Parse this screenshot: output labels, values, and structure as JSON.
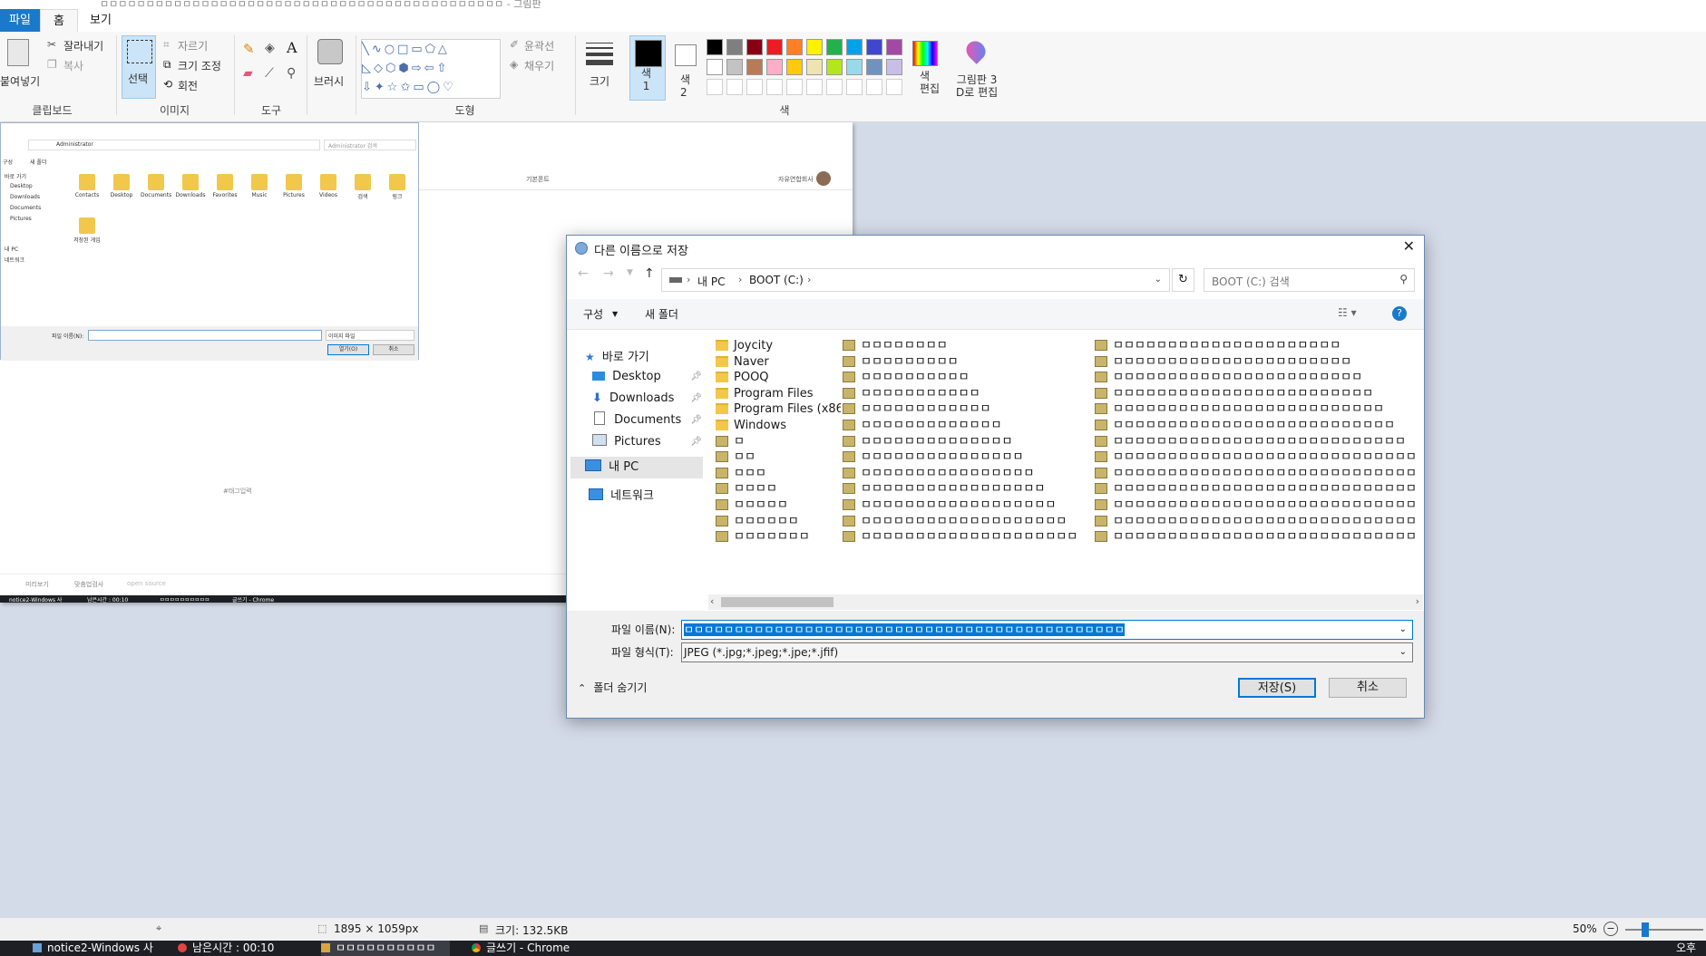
{
  "paint": {
    "title": "ㅁㅁㅁㅁㅁㅁㅁㅁㅁㅁㅁㅁㅁㅁㅁㅁㅁㅁㅁㅁㅁㅁㅁㅁㅁㅁㅁㅁㅁㅁㅁㅁㅁㅁㅁㅁㅁㅁㅁㅁㅁㅁㅁㅁ - 그림판",
    "tabs": [
      "파일",
      "홈",
      "보기"
    ],
    "clipboard": {
      "paste": "붙여넣기",
      "cut": "잘라내기",
      "copy": "복사",
      "group": "클립보드"
    },
    "image": {
      "select": "선택",
      "crop": "자르기",
      "resize": "크기 조정",
      "rotate": "회전",
      "group": "이미지"
    },
    "tools": {
      "group": "도구"
    },
    "brushes": {
      "label": "브러시"
    },
    "shapes": {
      "outline": "윤곽선",
      "fill": "채우기",
      "group": "도형"
    },
    "size": {
      "label": "크기"
    },
    "colors": {
      "color1": "색\n1",
      "color2": "색\n2",
      "edit": "색\n편집",
      "paint3d": "그림판 3\nD로 편집",
      "group": "색",
      "palette_row1": [
        "#000000",
        "#7f7f7f",
        "#880015",
        "#ed1c24",
        "#ff7f27",
        "#fff200",
        "#22b14c",
        "#00a2e8",
        "#3f48cc",
        "#a349a4"
      ],
      "palette_row2": [
        "#ffffff",
        "#c3c3c3",
        "#b97a57",
        "#ffaec9",
        "#ffc90e",
        "#efe4b0",
        "#b5e61d",
        "#99d9ea",
        "#7092be",
        "#c8bfe7"
      ]
    },
    "status": {
      "dimensions": "1895 × 1059px",
      "size": "크기: 132.5KB",
      "zoom": "50%"
    }
  },
  "canvas_content": {
    "mini_dialog": {
      "breadcrumb": "Administrator",
      "search": "Administrator 검색",
      "organize": "구성",
      "new_folder": "새 폴더",
      "nav": [
        "바로 가기",
        "Desktop",
        "Downloads",
        "Documents",
        "Pictures",
        "내 PC",
        "네트워크"
      ],
      "items": [
        "Contacts",
        "Desktop",
        "Documents",
        "Downloads",
        "Favorites",
        "Music",
        "Pictures",
        "Videos",
        "검색",
        "링크",
        "저장된 게임"
      ],
      "filename_label": "파일 이름(N):",
      "filetype": "이미지 파일",
      "open": "열기(O)",
      "cancel": "취소"
    },
    "editor_label": "기본폰트",
    "user": "자유연합회사",
    "tags": "#태그입력",
    "bottom": [
      "미리보기",
      "맞춤법검사",
      "open source"
    ],
    "taskbar": [
      "notice2-Windows 사",
      "남은시간 : 00:10",
      "ㅁㅁㅁㅁㅁㅁㅁㅁㅁㅁ",
      "글쓰기 - Chrome"
    ]
  },
  "dialog": {
    "title": "다른 이름으로 저장",
    "breadcrumb": [
      "내 PC",
      "BOOT (C:)"
    ],
    "search_placeholder": "BOOT (C:) 검색",
    "organize": "구성",
    "new_folder": "새 폴더",
    "nav": {
      "quick": "바로 가기",
      "desktop": "Desktop",
      "downloads": "Downloads",
      "documents": "Documents",
      "pictures": "Pictures",
      "mypc": "내 PC",
      "network": "네트워크"
    },
    "folders": [
      "Joycity",
      "Naver",
      "POOQ",
      "Program Files",
      "Program Files (x86)",
      "Windows"
    ],
    "col1_files": [
      "ㅁ",
      "ㅁㅁ",
      "ㅁㅁㅁ",
      "ㅁㅁㅁㅁ",
      "ㅁㅁㅁㅁㅁ",
      "ㅁㅁㅁㅁㅁㅁ",
      "ㅁㅁㅁㅁㅁㅁㅁ"
    ],
    "col2_files": [
      "ㅁㅁㅁㅁㅁㅁㅁㅁ",
      "ㅁㅁㅁㅁㅁㅁㅁㅁㅁ",
      "ㅁㅁㅁㅁㅁㅁㅁㅁㅁㅁ",
      "ㅁㅁㅁㅁㅁㅁㅁㅁㅁㅁㅁ",
      "ㅁㅁㅁㅁㅁㅁㅁㅁㅁㅁㅁㅁ",
      "ㅁㅁㅁㅁㅁㅁㅁㅁㅁㅁㅁㅁㅁ",
      "ㅁㅁㅁㅁㅁㅁㅁㅁㅁㅁㅁㅁㅁㅁ",
      "ㅁㅁㅁㅁㅁㅁㅁㅁㅁㅁㅁㅁㅁㅁㅁ",
      "ㅁㅁㅁㅁㅁㅁㅁㅁㅁㅁㅁㅁㅁㅁㅁㅁ",
      "ㅁㅁㅁㅁㅁㅁㅁㅁㅁㅁㅁㅁㅁㅁㅁㅁㅁ",
      "ㅁㅁㅁㅁㅁㅁㅁㅁㅁㅁㅁㅁㅁㅁㅁㅁㅁㅁ",
      "ㅁㅁㅁㅁㅁㅁㅁㅁㅁㅁㅁㅁㅁㅁㅁㅁㅁㅁㅁ",
      "ㅁㅁㅁㅁㅁㅁㅁㅁㅁㅁㅁㅁㅁㅁㅁㅁㅁㅁㅁㅁ"
    ],
    "col3_files": [
      "ㅁㅁㅁㅁㅁㅁㅁㅁㅁㅁㅁㅁㅁㅁㅁㅁㅁㅁㅁㅁㅁ",
      "ㅁㅁㅁㅁㅁㅁㅁㅁㅁㅁㅁㅁㅁㅁㅁㅁㅁㅁㅁㅁㅁㅁ",
      "ㅁㅁㅁㅁㅁㅁㅁㅁㅁㅁㅁㅁㅁㅁㅁㅁㅁㅁㅁㅁㅁㅁㅁ",
      "ㅁㅁㅁㅁㅁㅁㅁㅁㅁㅁㅁㅁㅁㅁㅁㅁㅁㅁㅁㅁㅁㅁㅁㅁ",
      "ㅁㅁㅁㅁㅁㅁㅁㅁㅁㅁㅁㅁㅁㅁㅁㅁㅁㅁㅁㅁㅁㅁㅁㅁㅁ",
      "ㅁㅁㅁㅁㅁㅁㅁㅁㅁㅁㅁㅁㅁㅁㅁㅁㅁㅁㅁㅁㅁㅁㅁㅁㅁㅁ",
      "ㅁㅁㅁㅁㅁㅁㅁㅁㅁㅁㅁㅁㅁㅁㅁㅁㅁㅁㅁㅁㅁㅁㅁㅁㅁㅁㅁ",
      "ㅁㅁㅁㅁㅁㅁㅁㅁㅁㅁㅁㅁㅁㅁㅁㅁㅁㅁㅁㅁㅁㅁㅁㅁㅁㅁㅁㅁ",
      "ㅁㅁㅁㅁㅁㅁㅁㅁㅁㅁㅁㅁㅁㅁㅁㅁㅁㅁㅁㅁㅁㅁㅁㅁㅁㅁㅁㅁ",
      "ㅁㅁㅁㅁㅁㅁㅁㅁㅁㅁㅁㅁㅁㅁㅁㅁㅁㅁㅁㅁㅁㅁㅁㅁㅁㅁㅁㅁ",
      "ㅁㅁㅁㅁㅁㅁㅁㅁㅁㅁㅁㅁㅁㅁㅁㅁㅁㅁㅁㅁㅁㅁㅁㅁㅁㅁㅁㅁ",
      "ㅁㅁㅁㅁㅁㅁㅁㅁㅁㅁㅁㅁㅁㅁㅁㅁㅁㅁㅁㅁㅁㅁㅁㅁㅁㅁㅁㅁ",
      "ㅁㅁㅁㅁㅁㅁㅁㅁㅁㅁㅁㅁㅁㅁㅁㅁㅁㅁㅁㅁㅁㅁㅁㅁㅁㅁㅁㅁ"
    ],
    "filename_label": "파일 이름(N):",
    "filename_value": "ㅁㅁㅁㅁㅁㅁㅁㅁㅁㅁㅁㅁㅁㅁㅁㅁㅁㅁㅁㅁㅁㅁㅁㅁㅁㅁㅁㅁㅁㅁㅁㅁㅁㅁㅁㅁㅁㅁㅁㅁㅁㅁㅁㅁ",
    "filetype_label": "파일 형식(T):",
    "filetype_value": "JPEG (*.jpg;*.jpeg;*.jpe;*.jfif)",
    "hide_folders": "폴더 숨기기",
    "save": "저장(S)",
    "cancel": "취소"
  },
  "taskbar": {
    "items": [
      "notice2-Windows 사",
      "남은시간 : 00:10",
      "ㅁㅁㅁㅁㅁㅁㅁㅁㅁㅁ",
      "글쓰기 - Chrome"
    ],
    "time": "오후"
  }
}
